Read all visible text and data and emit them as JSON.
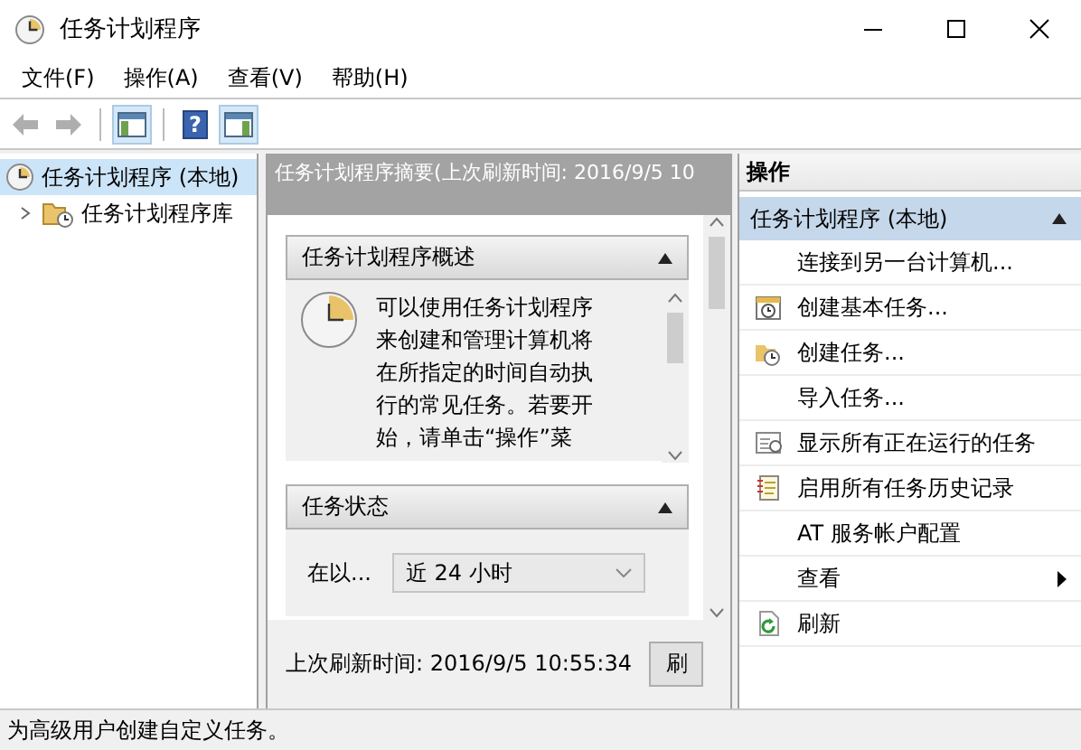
{
  "window": {
    "title": "任务计划程序"
  },
  "menu": [
    "文件(F)",
    "操作(A)",
    "查看(V)",
    "帮助(H)"
  ],
  "toolbar": [
    {
      "kind": "back",
      "disabled": true,
      "pressed": false
    },
    {
      "kind": "forward",
      "disabled": true,
      "pressed": false
    },
    {
      "kind": "console-tree",
      "disabled": false,
      "pressed": true
    },
    {
      "kind": "help",
      "disabled": false,
      "pressed": false,
      "label": "?"
    },
    {
      "kind": "action-pane",
      "disabled": false,
      "pressed": true
    }
  ],
  "tree": [
    {
      "label": "任务计划程序 (本地)",
      "selected": true,
      "children": [
        {
          "label": "任务计划程序库",
          "selected": false,
          "expanded": false
        }
      ]
    }
  ],
  "summary": {
    "header": "任务计划程序摘要(上次刷新时间: 2016/9/5 10",
    "sections": [
      {
        "kind": "overview",
        "title": "任务计划程序概述",
        "expanded": true,
        "text": "可以使用任务计划程序来创建和管理计算机将在所指定的时间自动执行的常见任务。若要开始，请单击“操作”菜"
      },
      {
        "kind": "status",
        "title": "任务状态",
        "expanded": true,
        "filter_label": "在以...",
        "filter_value": "近 24 小时"
      }
    ],
    "last_refresh": "上次刷新时间: 2016/9/5 10:55:34",
    "refresh_button": "刷"
  },
  "actions": {
    "title": "操作",
    "group": {
      "label": "任务计划程序 (本地)",
      "expanded": true
    },
    "items": [
      {
        "kind": "plain",
        "label": "连接到另一台计算机..."
      },
      {
        "kind": "basic-task",
        "label": "创建基本任务..."
      },
      {
        "kind": "new-task",
        "label": "创建任务..."
      },
      {
        "kind": "plain",
        "label": "导入任务..."
      },
      {
        "kind": "running",
        "label": "显示所有正在运行的任务"
      },
      {
        "kind": "history",
        "label": "启用所有任务历史记录"
      },
      {
        "kind": "plain",
        "label": "AT 服务帐户配置"
      },
      {
        "kind": "submenu",
        "label": "查看"
      },
      {
        "kind": "refresh",
        "label": "刷新"
      }
    ]
  },
  "status_bar": "为高级用户创建自定义任务。"
}
